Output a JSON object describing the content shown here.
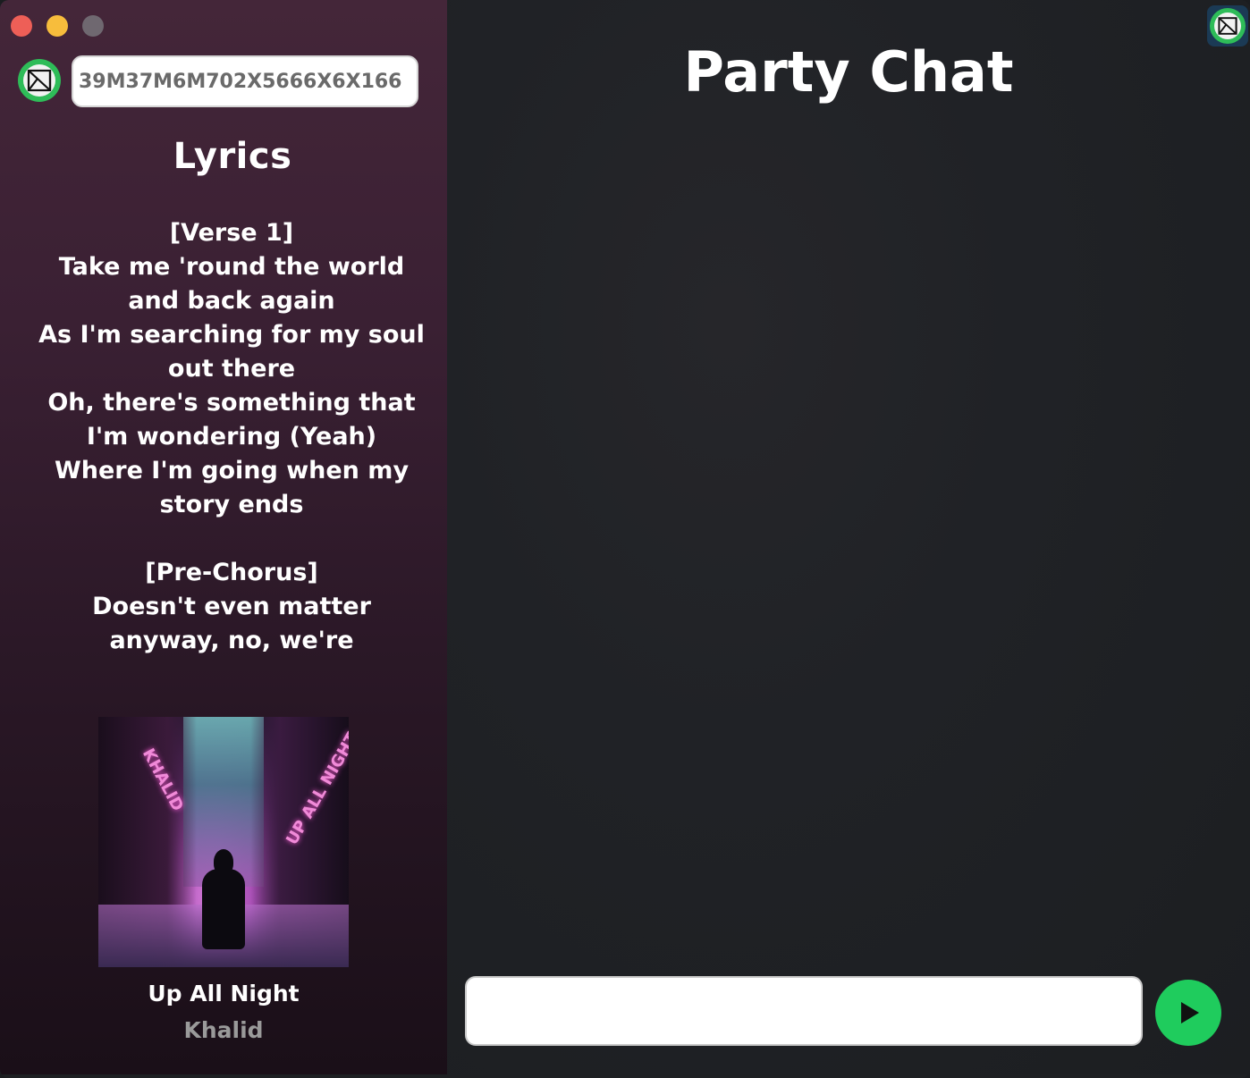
{
  "window": {
    "controls": [
      "close",
      "minimize",
      "maximize"
    ],
    "colors": {
      "close": "#ee5f57",
      "minimize": "#f7bd3c",
      "maximize": "#6f6870",
      "accent_green": "#1fcc5d"
    }
  },
  "sidebar": {
    "logo_icon": "envelope-logo-icon",
    "room_code": {
      "value": "39M37M6M702X5666X6X166",
      "placeholder": ""
    },
    "lyrics": {
      "title": "Lyrics",
      "lines": [
        "[Verse 1]",
        "Take me 'round the world",
        "and back again",
        "As I'm searching for my soul",
        "out there",
        "Oh,  there's  something that",
        "I'm  wondering (Yeah)",
        "Where I'm going when my",
        "story ends",
        "",
        "[Pre-Chorus]",
        "Doesn't even matter",
        "anyway, no, we're"
      ]
    },
    "now_playing": {
      "album_art_text_left": "KHALID",
      "album_art_text_right": "UP ALL NIGHT",
      "song_title": "Up All Night",
      "artist": "Khalid"
    }
  },
  "chat": {
    "title": "Party Chat",
    "corner_icon": "envelope-logo-icon",
    "message_input": {
      "value": "",
      "placeholder": ""
    },
    "send_icon": "play-send-icon"
  }
}
